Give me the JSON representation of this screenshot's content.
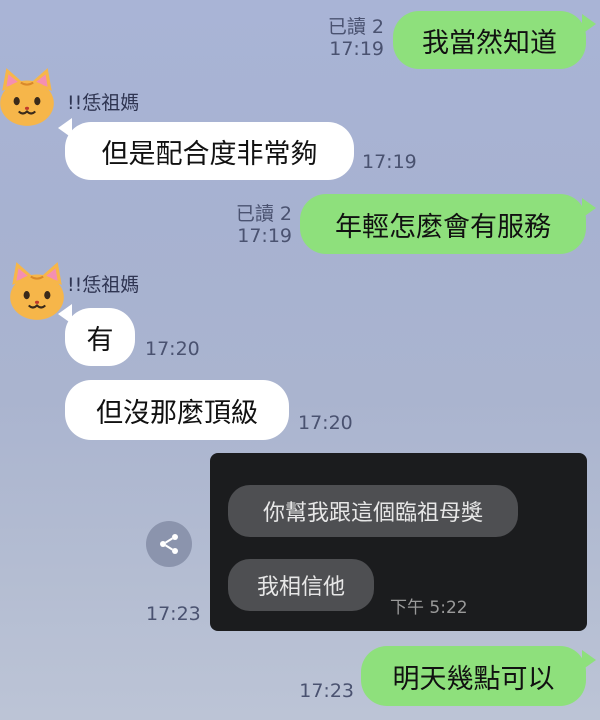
{
  "messages": [
    {
      "id": "m1",
      "direction": "out",
      "text": "我當然知道",
      "read": "已讀 2",
      "time": "17:19"
    },
    {
      "id": "m2",
      "direction": "in",
      "sender": "!!恁祖媽",
      "text": "但是配合度非常夠",
      "time": "17:19"
    },
    {
      "id": "m3",
      "direction": "out",
      "text": "年輕怎麼會有服務",
      "read": "已讀 2",
      "time": "17:19"
    },
    {
      "id": "m4",
      "direction": "in",
      "sender": "!!恁祖媽",
      "text": "有",
      "time": "17:20"
    },
    {
      "id": "m5",
      "direction": "in",
      "text": "但沒那麼頂級",
      "time": "17:20"
    },
    {
      "id": "m6",
      "direction": "in",
      "type": "image",
      "time": "17:23",
      "image": {
        "bubbles": [
          "你幫我跟這個臨祖母獎",
          "我相信他"
        ],
        "time": "下午 5:22"
      }
    },
    {
      "id": "m7",
      "direction": "out",
      "text": "明天幾點可以",
      "time": "17:23"
    }
  ],
  "avatar": {
    "icon": "cat-face-icon",
    "colors": {
      "fur": "#f6b64a",
      "stripe": "#d9892a"
    }
  },
  "colors": {
    "outgoing": "#8ee07c",
    "incoming": "#ffffff",
    "background": "#a9b4d6"
  },
  "share": {
    "icon": "share-icon"
  }
}
